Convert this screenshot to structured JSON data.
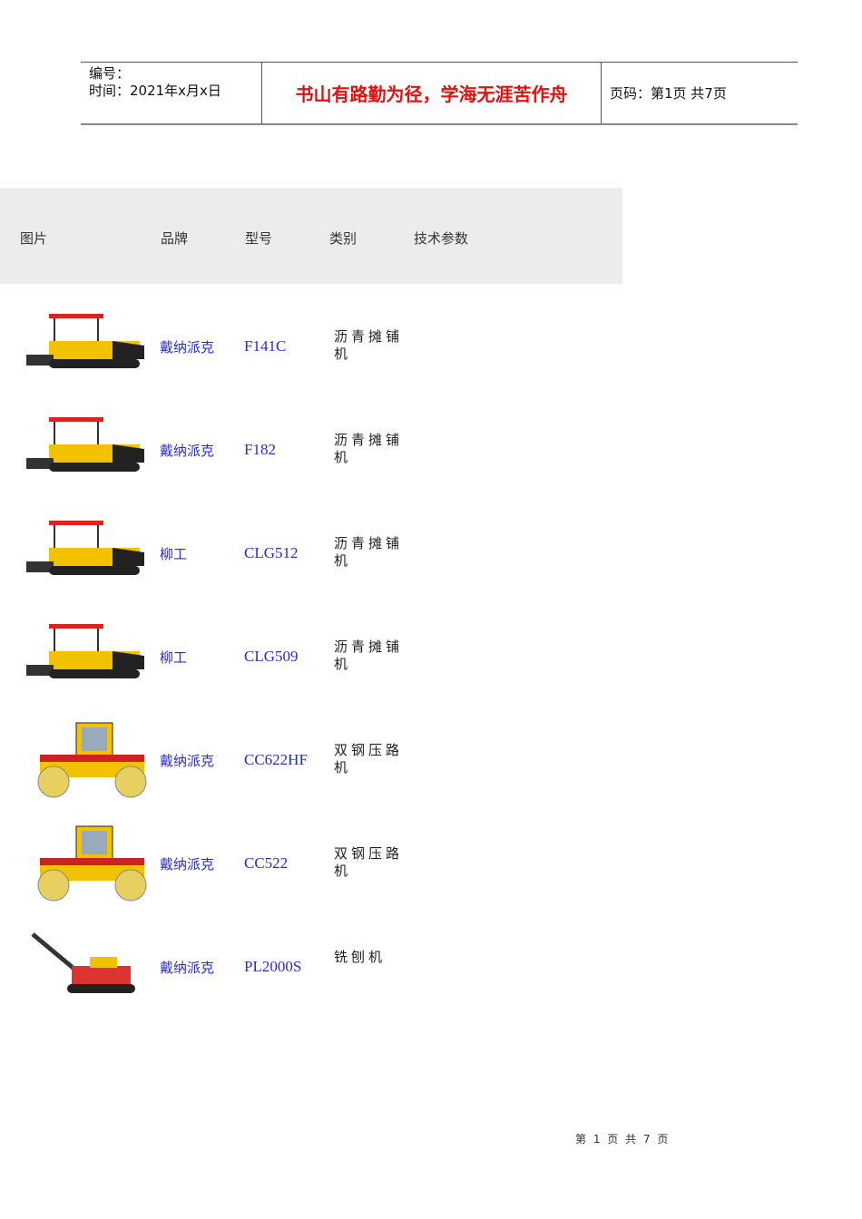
{
  "header": {
    "number_label": "编号：",
    "date_label": "时间：2021年x月x日",
    "motto": "书山有路勤为径，学海无涯苦作舟",
    "page_label": "页码：第1页  共7页"
  },
  "table": {
    "columns": [
      "图片",
      "品牌",
      "型号",
      "类别",
      "技术参数"
    ],
    "rows": [
      {
        "brand": "戴纳派克",
        "model": "F141C",
        "category": "沥青摊铺机",
        "kind": "paver"
      },
      {
        "brand": "戴纳派克",
        "model": "F182",
        "category": "沥青摊铺机",
        "kind": "paver"
      },
      {
        "brand": "柳工",
        "model": "CLG512",
        "category": "沥青摊铺机",
        "kind": "paver"
      },
      {
        "brand": "柳工",
        "model": "CLG509",
        "category": "沥青摊铺机",
        "kind": "paver"
      },
      {
        "brand": "戴纳派克",
        "model": "CC622HF",
        "category": "双钢压路机",
        "kind": "roller"
      },
      {
        "brand": "戴纳派克",
        "model": "CC522",
        "category": "双钢压路机",
        "kind": "roller"
      },
      {
        "brand": "戴纳派克",
        "model": "PL2000S",
        "category": "铣刨机",
        "kind": "milling"
      }
    ]
  },
  "footer": {
    "page_text": "第 1 页 共 7 页"
  }
}
